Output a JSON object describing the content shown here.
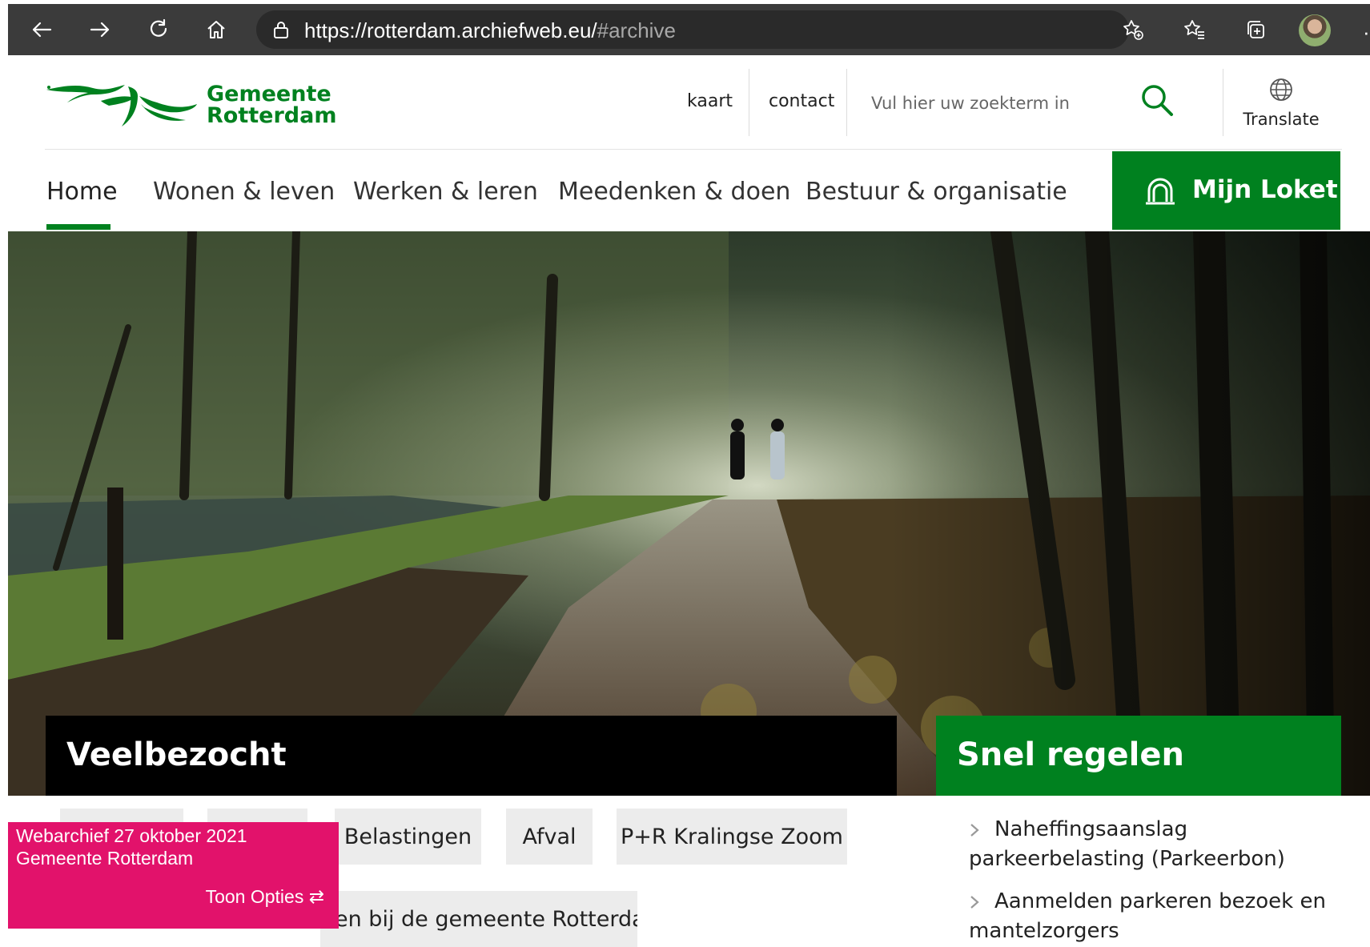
{
  "browser": {
    "url_main": "https://rotterdam.archiefweb.eu/",
    "url_hash": "#archive"
  },
  "header": {
    "logo_line1": "Gemeente",
    "logo_line2": "Rotterdam",
    "link_kaart": "kaart",
    "link_contact": "contact",
    "search_placeholder": "Vul hier uw zoekterm in",
    "translate_label": "Translate"
  },
  "nav": {
    "items": [
      "Home",
      "Wonen & leven",
      "Werken & leren",
      "Meedenken & doen",
      "Bestuur & organisatie"
    ],
    "active": "Home",
    "mijn_loket": "Mijn Loket"
  },
  "veelbezocht": {
    "title": "Veelbezocht",
    "chips": [
      "Belastingen",
      "Afval",
      "P+R Kralingse Zoom"
    ],
    "second_row": "en bij de gemeente Rotterdam"
  },
  "snel_regelen": {
    "title": "Snel regelen",
    "items": [
      {
        "line1": "Naheffingsaanslag",
        "line2": "parkeerbelasting (Parkeerbon)"
      },
      {
        "line1": "Aanmelden parkeren bezoek en",
        "line2": "mantelzorgers"
      }
    ]
  },
  "archive_banner": {
    "line1": "Webarchief 27 oktober 2021",
    "line2": "Gemeente Rotterdam",
    "options": "Toon Opties ⇄"
  },
  "colors": {
    "brand_green": "#00811f",
    "banner_pink": "#e2126b",
    "chrome_dark": "#3b3b3b"
  }
}
